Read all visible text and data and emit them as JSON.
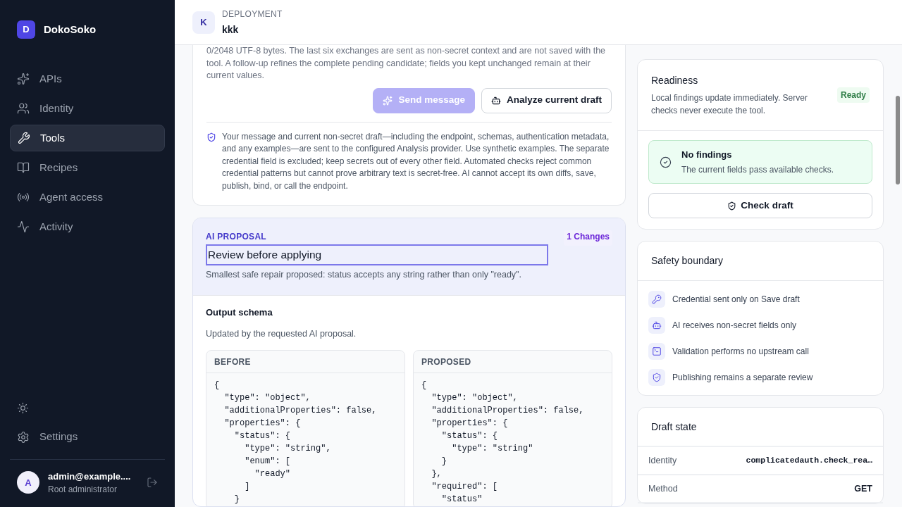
{
  "brand": {
    "initial": "D",
    "name": "DokoSoko"
  },
  "nav": [
    {
      "label": "APIs",
      "selected": false
    },
    {
      "label": "Identity",
      "selected": false
    },
    {
      "label": "Tools",
      "selected": true
    },
    {
      "label": "Recipes",
      "selected": false
    },
    {
      "label": "Agent access",
      "selected": false
    },
    {
      "label": "Activity",
      "selected": false
    }
  ],
  "settings": {
    "label": "Settings"
  },
  "user": {
    "initial": "A",
    "email": "admin@example....",
    "role": "Root administrator"
  },
  "header": {
    "initial": "K",
    "eyebrow": "DEPLOYMENT",
    "title": "kkk"
  },
  "message_card": {
    "hint": "0/2048 UTF-8 bytes. The last six exchanges are sent as non-secret context and are not saved with the tool. A follow-up refines the complete pending candidate; fields you kept unchanged remain at their current values.",
    "buttons": [
      {
        "label": "Send message",
        "kind": "primary",
        "disabled": true
      },
      {
        "label": "Analyze current draft",
        "kind": "secondary",
        "disabled": false
      }
    ],
    "notice": "Your message and current non-secret draft—including the endpoint, schemas, authentication metadata, and any examples—are sent to the configured Analysis provider. Use synthetic examples. The separate credential field is excluded; keep secrets out of every other field. Automated checks reject common credential patterns but cannot prove arbitrary text is secret-free. AI cannot accept its own diffs, save, publish, bind, or call the endpoint."
  },
  "proposal": {
    "eyebrow": "AI PROPOSAL",
    "title": "Review before applying",
    "changes": "1 Changes",
    "summary": "Smallest safe repair proposed: status accepts any string rather than only \"ready\".",
    "section_title": "Output schema",
    "section_note": "Updated by the requested AI proposal.",
    "panes": [
      {
        "label": "BEFORE",
        "lines": [
          "{",
          "  \"type\": \"object\",",
          "  \"additionalProperties\": false,",
          "  \"properties\": {",
          "    \"status\": {",
          "      \"type\": \"string\",",
          "      \"enum\": [",
          "        \"ready\"",
          "      ]",
          "    }"
        ]
      },
      {
        "label": "PROPOSED",
        "lines": [
          "{",
          "  \"type\": \"object\",",
          "  \"additionalProperties\": false,",
          "  \"properties\": {",
          "    \"status\": {",
          "      \"type\": \"string\"",
          "    }",
          "  },",
          "  \"required\": [",
          "    \"status\""
        ]
      }
    ]
  },
  "readiness": {
    "title": "Readiness",
    "note": "Local findings update immediately. Server checks never execute the tool.",
    "badge": "Ready",
    "finding_title": "No findings",
    "finding_note": "The current fields pass available checks.",
    "button": "Check draft"
  },
  "safety": {
    "title": "Safety boundary",
    "items": [
      {
        "label": "Credential sent only on Save draft"
      },
      {
        "label": "AI receives non-secret fields only"
      },
      {
        "label": "Validation performs no upstream call"
      },
      {
        "label": "Publishing remains a separate review"
      }
    ]
  },
  "draft_state": {
    "title": "Draft state",
    "rows": [
      {
        "label": "Identity",
        "value": "complicatedauth.check_rea…",
        "kind": "mono"
      },
      {
        "label": "Method",
        "value": "GET",
        "kind": "bold"
      }
    ]
  }
}
